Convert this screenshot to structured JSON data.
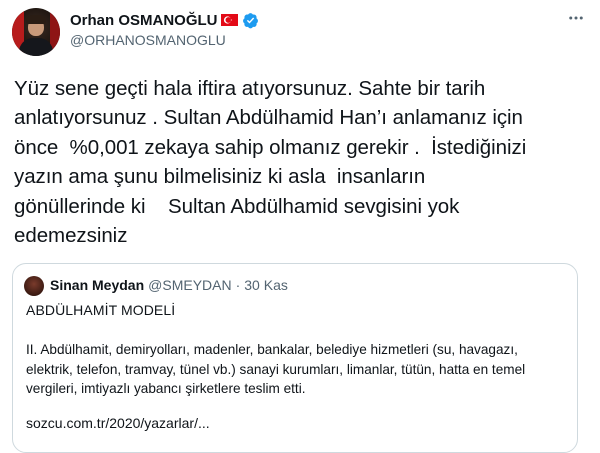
{
  "author": {
    "display_name": "Orhan OSMANOĞLU",
    "handle": "@ORHANOSMANOGLU",
    "flag_icon": "turkey-flag-icon",
    "verified_icon": "verified-badge-icon",
    "verified_color": "#1d9bf0"
  },
  "tweet": {
    "text": "Yüz sene geçti hala iftira atıyorsunuz. Sahte bir tarih\nanlatıyorsunuz . Sultan Abdülhamid Han’ı anlamanız için\nönce  %0,001 zekaya sahip olmanız gerekir .  İstediğinizi\nyazın ama şunu bilmelisiniz ki asla  insanların\ngönüllerinde ki    Sultan Abdülhamid sevgisini yok\nedemezsiniz"
  },
  "quoted": {
    "display_name": "Sinan Meydan",
    "handle": "@SMEYDAN",
    "separator": "·",
    "date": "30 Kas",
    "title": "ABDÜLHAMİT MODELİ",
    "body": "II. Abdülhamit, demiryolları, madenler, bankalar, belediye hizmetleri (su, havagazı, elektrik, telefon, tramvay, tünel vb.) sanayi kurumları, limanlar, tütün, hatta en temel vergileri, imtiyazlı yabancı şirketlere teslim etti.",
    "link": "sozcu.com.tr/2020/yazarlar/..."
  },
  "colors": {
    "text": "#0f1419",
    "secondary": "#536471",
    "border": "#cfd9de",
    "flag_red": "#e30a17"
  }
}
